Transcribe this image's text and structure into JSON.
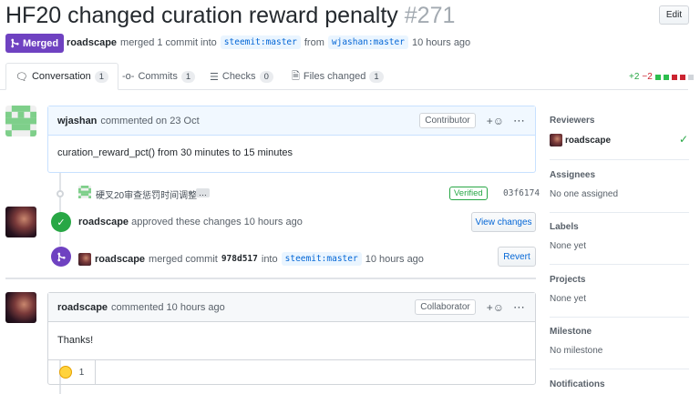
{
  "pr": {
    "title": "HF20 changed curation reward penalty",
    "number": "#271",
    "edit_label": "Edit",
    "state": "Merged",
    "author": "roadscape",
    "merged_text": "merged 1 commit into",
    "base_branch": "steemit:master",
    "from_text": "from",
    "head_branch": "wjashan:master",
    "time": "10 hours ago"
  },
  "tabs": [
    {
      "label": "Conversation",
      "count": "1"
    },
    {
      "label": "Commits",
      "count": "1"
    },
    {
      "label": "Checks",
      "count": "0"
    },
    {
      "label": "Files changed",
      "count": "1"
    }
  ],
  "diffstat": {
    "additions": "+2",
    "deletions": "−2"
  },
  "comment1": {
    "author": "wjashan",
    "action": "commented on 23 Oct",
    "role": "Contributor",
    "body": "curation_reward_pct() from 30 minutes to 15 minutes"
  },
  "commit": {
    "message": "硬叉20审查惩罚时间调整",
    "ellipsis": "…",
    "verified": "Verified",
    "sha": "03f6174"
  },
  "review": {
    "author": "roadscape",
    "text": "approved these changes 10 hours ago",
    "button": "View changes"
  },
  "merge_event": {
    "author": "roadscape",
    "text": "merged commit",
    "sha": "978d517",
    "into": "into",
    "branch": "steemit:master",
    "time": "10 hours ago",
    "button": "Revert"
  },
  "comment2": {
    "author": "roadscape",
    "action": "commented 10 hours ago",
    "role": "Collaborator",
    "body": "Thanks!",
    "reaction_count": "1"
  },
  "sidebar": {
    "reviewers_label": "Reviewers",
    "reviewer": "roadscape",
    "assignees_label": "Assignees",
    "assignees_value": "No one assigned",
    "labels_label": "Labels",
    "labels_value": "None yet",
    "projects_label": "Projects",
    "projects_value": "None yet",
    "milestone_label": "Milestone",
    "milestone_value": "No milestone",
    "notifications_label": "Notifications"
  },
  "colors": {
    "merged": "#6f42c1",
    "approved": "#28a745",
    "link": "#0366d6",
    "identicon": "#7ecf8a"
  },
  "icons": [
    "merge-icon",
    "comment-icon",
    "commit-icon",
    "checks-icon",
    "file-diff-icon",
    "check-icon",
    "smiley-icon",
    "kebab-icon"
  ]
}
